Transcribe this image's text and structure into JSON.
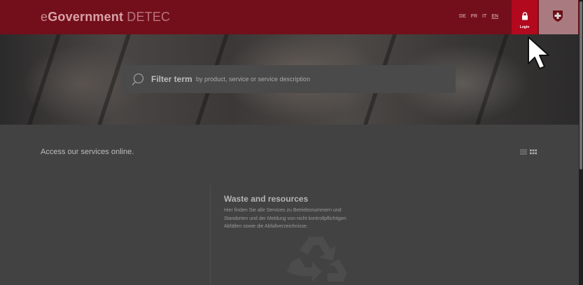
{
  "header": {
    "brand_e": "e",
    "brand_government": "Government",
    "brand_detec": "DETEC",
    "languages": [
      "DE",
      "FR",
      "IT",
      "EN"
    ],
    "active_language": "EN",
    "login_label": "Login"
  },
  "search": {
    "term_label": "Filter term",
    "description": "by product, service or service description"
  },
  "main": {
    "heading": "Access our services online.",
    "card": {
      "title": "Waste and resources",
      "description": "Hier finden Sie alle Services zu Betriebsnummern und Standorten und der Meldung von nicht kontrollpflichtigen Abfällen sowie die Abfallverzeichnisse."
    }
  },
  "icons": [
    "lock-icon",
    "swiss-shield-icon",
    "search-icon",
    "list-view-icon",
    "grid-view-icon",
    "recycle-icon",
    "mouse-cursor"
  ],
  "colors": {
    "header_bg": "#730f1b",
    "login_tab": "#b3091e",
    "overlay_bg": "#424242"
  }
}
